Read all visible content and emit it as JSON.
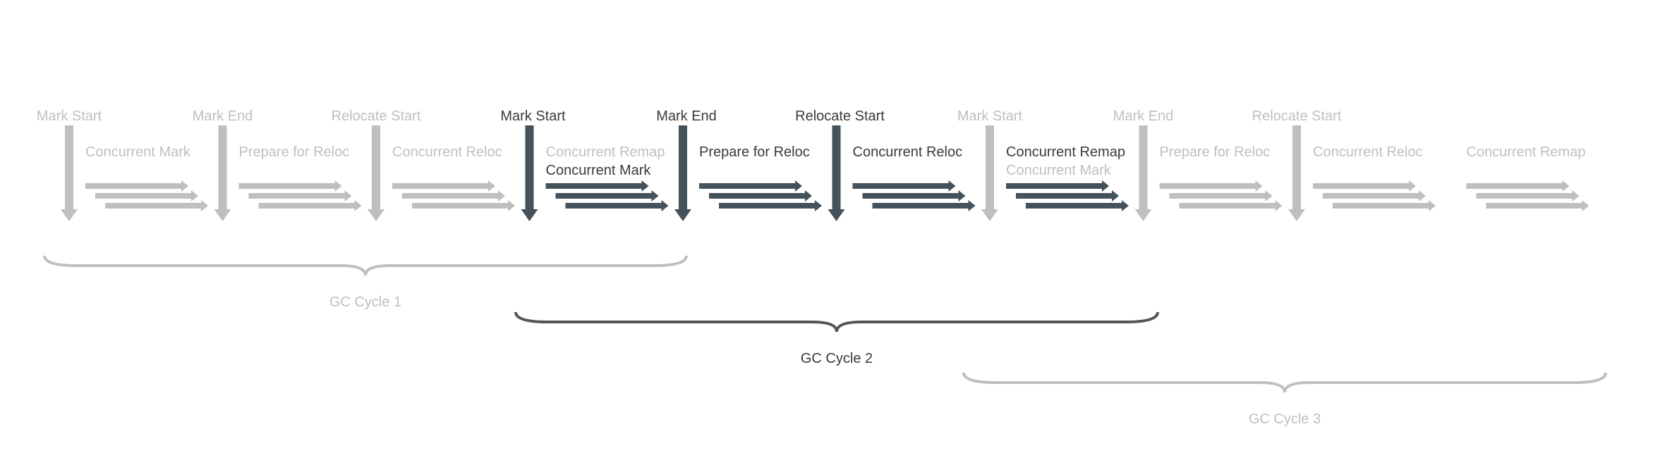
{
  "colors": {
    "inactive": "#bfbfbf",
    "active": "#44525c",
    "active_text": "#3a3a3a",
    "brace_active": "#555555"
  },
  "markers": [
    {
      "label": "Mark Start",
      "active": false
    },
    {
      "label": "Mark End",
      "active": false
    },
    {
      "label": "Relocate Start",
      "active": false
    },
    {
      "label": "Mark Start",
      "active": true
    },
    {
      "label": "Mark End",
      "active": true
    },
    {
      "label": "Relocate Start",
      "active": true
    },
    {
      "label": "Mark Start",
      "active": false
    },
    {
      "label": "Mark End",
      "active": false
    },
    {
      "label": "Relocate Start",
      "active": false
    }
  ],
  "phases": [
    {
      "lines": [
        {
          "text": "Concurrent Mark",
          "active": false
        }
      ],
      "active": false
    },
    {
      "lines": [
        {
          "text": "Prepare for Reloc",
          "active": false
        }
      ],
      "active": false
    },
    {
      "lines": [
        {
          "text": "Concurrent Reloc",
          "active": false
        }
      ],
      "active": false
    },
    {
      "lines": [
        {
          "text": "Concurrent Remap",
          "active": false
        },
        {
          "text": "Concurrent Mark",
          "active": true
        }
      ],
      "active": true
    },
    {
      "lines": [
        {
          "text": "Prepare for Reloc",
          "active": true
        }
      ],
      "active": true
    },
    {
      "lines": [
        {
          "text": "Concurrent Reloc",
          "active": true
        }
      ],
      "active": true
    },
    {
      "lines": [
        {
          "text": "Concurrent Remap",
          "active": true
        },
        {
          "text": "Concurrent Mark",
          "active": false
        }
      ],
      "active": true
    },
    {
      "lines": [
        {
          "text": "Prepare for Reloc",
          "active": false
        }
      ],
      "active": false
    },
    {
      "lines": [
        {
          "text": "Concurrent Reloc",
          "active": false
        }
      ],
      "active": false
    },
    {
      "lines": [
        {
          "text": "Concurrent Remap",
          "active": false
        }
      ],
      "active": false
    }
  ],
  "cycles": [
    {
      "label": "GC Cycle 1",
      "active": false
    },
    {
      "label": "GC Cycle 2",
      "active": true
    },
    {
      "label": "GC Cycle 3",
      "active": false
    }
  ]
}
